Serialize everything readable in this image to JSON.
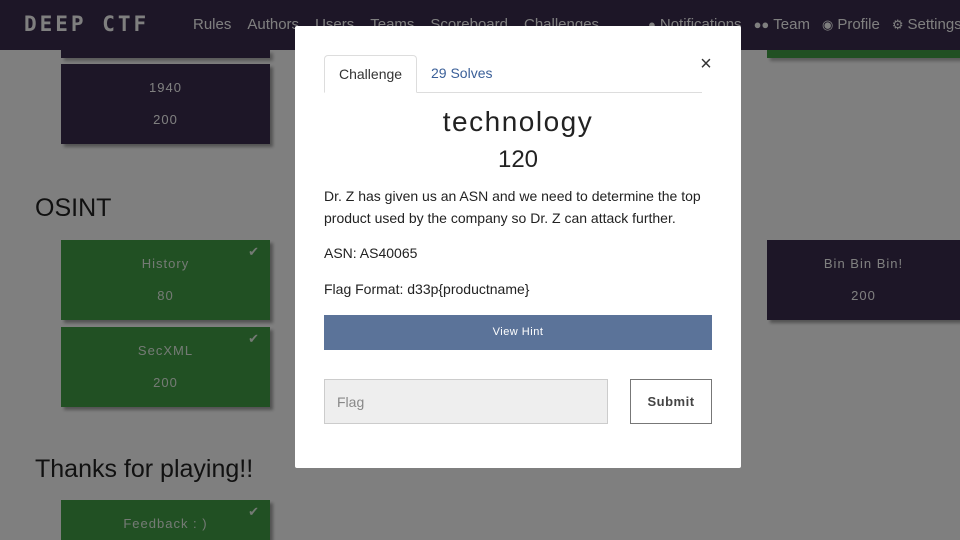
{
  "navbar": {
    "brand": "DEEP CTF",
    "links": [
      "Rules",
      "Authors",
      "Users",
      "Teams",
      "Scoreboard",
      "Challenges"
    ],
    "right": {
      "notifications": "Notifications",
      "team": "Team",
      "profile": "Profile",
      "settings": "Settings"
    }
  },
  "categories": {
    "osint": "OSINT",
    "thanks": "Thanks for playing!!"
  },
  "cards": {
    "c1940": {
      "name": "1940",
      "value": "200"
    },
    "history": {
      "name": "History",
      "value": "80"
    },
    "secxml": {
      "name": "SecXML",
      "value": "200"
    },
    "binbin": {
      "name": "Bin Bin Bin!",
      "value": "200"
    },
    "feedback": {
      "name": "Feedback : )"
    },
    "check_glyph": "✔"
  },
  "modal": {
    "close": "×",
    "tabs": {
      "challenge": "Challenge",
      "solves": "29 Solves"
    },
    "name": "technology",
    "value": "120",
    "description": "Dr. Z has given us an ASN and we need to determine the top product used by the company so Dr. Z can attack further.",
    "asn": "ASN: AS40065",
    "flag_format": "Flag Format: d33p{productname}",
    "hint_label": "View Hint",
    "flag_placeholder": "Flag",
    "submit_label": "Submit"
  },
  "colors": {
    "navbar": "#3b2d4f",
    "unsolved": "#3b2d4f",
    "solved": "#43a047",
    "hint_button": "#5b7399",
    "tab_link": "#3a5f98"
  }
}
